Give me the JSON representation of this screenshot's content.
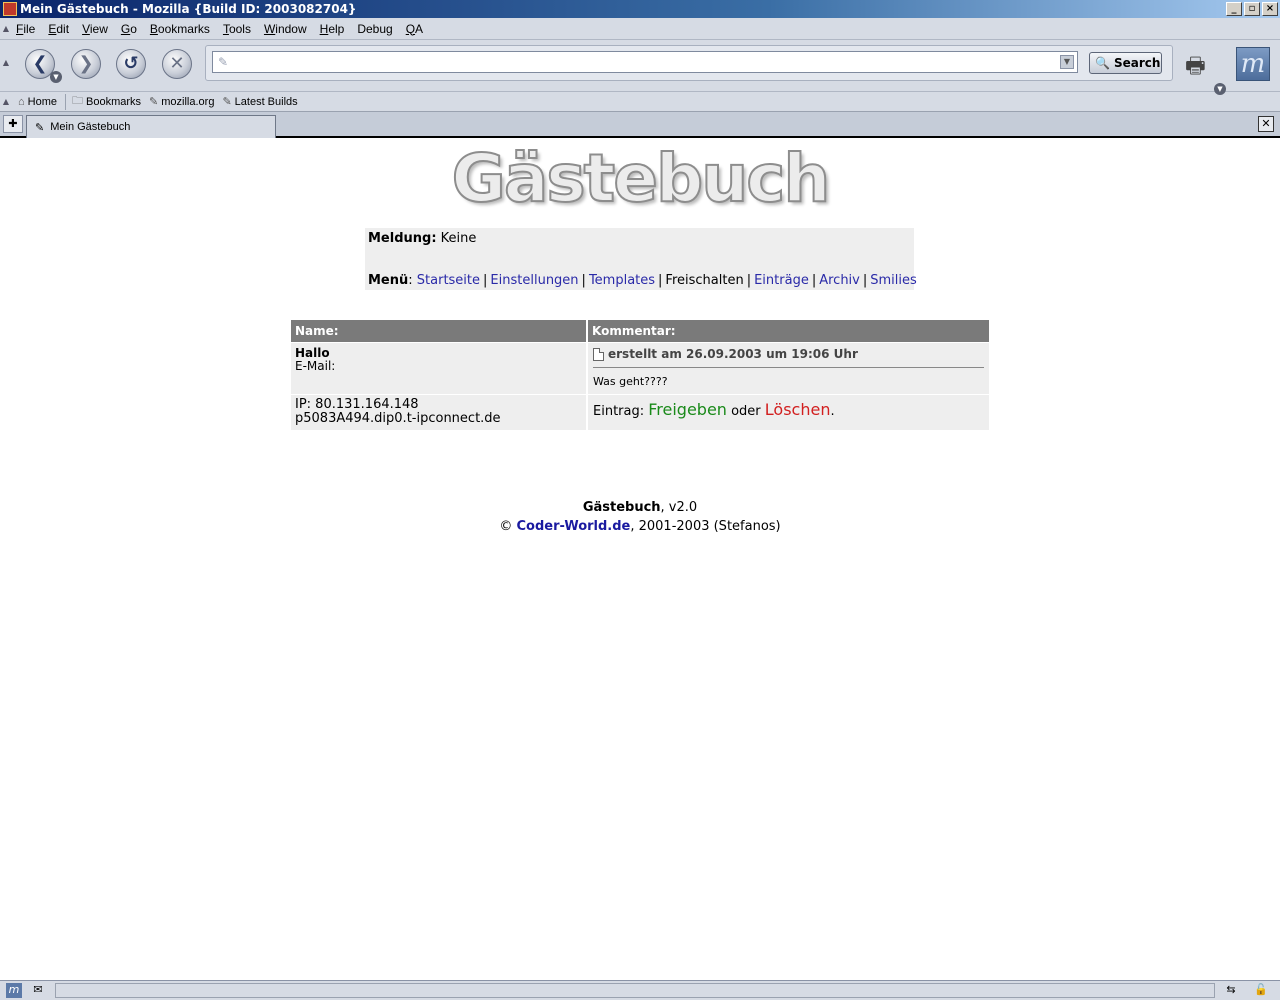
{
  "window": {
    "title": "Mein Gästebuch - Mozilla {Build ID: 2003082704}",
    "controls": {
      "minimize": "_",
      "maximize": "▫",
      "close": "×"
    }
  },
  "menubar": [
    {
      "label": "File",
      "accel": "F",
      "rest": "ile"
    },
    {
      "label": "Edit",
      "accel": "E",
      "rest": "dit"
    },
    {
      "label": "View",
      "accel": "V",
      "rest": "iew"
    },
    {
      "label": "Go",
      "accel": "G",
      "rest": "o"
    },
    {
      "label": "Bookmarks",
      "accel": "B",
      "rest": "ookmarks"
    },
    {
      "label": "Tools",
      "accel": "T",
      "rest": "ools"
    },
    {
      "label": "Window",
      "accel": "W",
      "rest": "indow"
    },
    {
      "label": "Help",
      "accel": "H",
      "rest": "elp"
    },
    {
      "label": "Debug",
      "accel": "",
      "rest": "Debug"
    },
    {
      "label": "QA",
      "accel": "Q",
      "rest": "A"
    }
  ],
  "navigation": {
    "back_glyph": "❮",
    "forward_glyph": "❯",
    "reload_glyph": "↺",
    "stop_glyph": "✕",
    "url_value": "",
    "search_label": "Search",
    "throbber_letter": "m"
  },
  "personal_toolbar": {
    "home": "Home",
    "bookmarks": "Bookmarks",
    "items": [
      "mozilla.org",
      "Latest Builds"
    ]
  },
  "tabs": {
    "active_tab": "Mein Gästebuch"
  },
  "page": {
    "logo_text": "Gästebuch",
    "notice_label": "Meldung:",
    "notice_value": "Keine",
    "menu_label": "Menü",
    "menu_links": [
      {
        "text": "Startseite",
        "link": true
      },
      {
        "text": "Einstellungen",
        "link": true
      },
      {
        "text": "Templates",
        "link": true
      },
      {
        "text": "Freischalten",
        "link": false
      },
      {
        "text": "Einträge",
        "link": true
      },
      {
        "text": "Archiv",
        "link": true
      },
      {
        "text": "Smilies",
        "link": true
      }
    ],
    "table": {
      "header_name": "Name:",
      "header_comment": "Kommentar:",
      "entry": {
        "name": "Hallo",
        "email_label": "E-Mail:",
        "created": "erstellt am 26.09.2003 um 19:06 Uhr",
        "message": "Was geht????",
        "ip": "IP: 80.131.164.148",
        "host": "p5083A494.dip0.t-ipconnect.de",
        "action_prefix": "Eintrag:",
        "approve": "Freigeben",
        "or": "oder",
        "delete": "Löschen",
        "period": "."
      }
    },
    "footer": {
      "product": "Gästebuch",
      "version": ", v2.0",
      "copyright": "©",
      "site": "Coder-World.de",
      "years": ", 2001-2003 (Stefanos)"
    }
  },
  "colors": {
    "link": "#2a2aa8",
    "approve": "#1a8a1a",
    "delete": "#d21f1f",
    "table_header": "#7a7a7a",
    "cell_bg": "#eeeeee"
  }
}
